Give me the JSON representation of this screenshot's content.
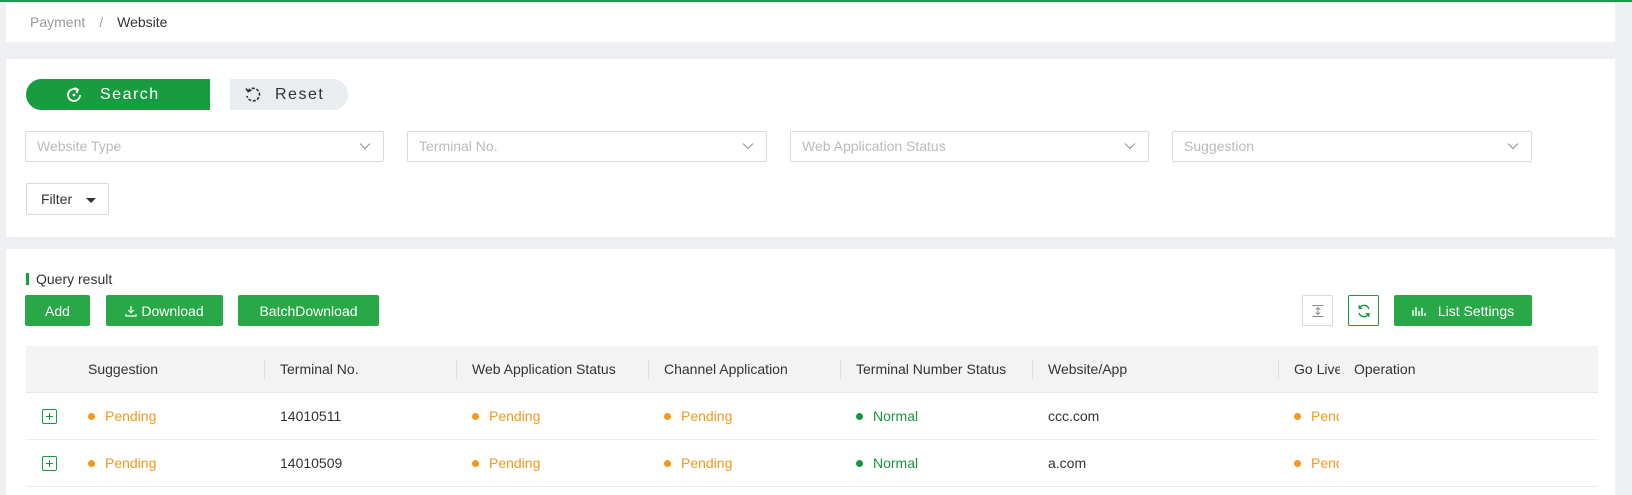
{
  "breadcrumb": {
    "parent": "Payment",
    "separator": "/",
    "current": "Website"
  },
  "search": {
    "search_label": "Search",
    "reset_label": "Reset"
  },
  "filters": [
    {
      "placeholder": "Website Type"
    },
    {
      "placeholder": "Terminal No."
    },
    {
      "placeholder": "Web Application Status"
    },
    {
      "placeholder": "Suggestion"
    }
  ],
  "filter_button": "Filter",
  "result": {
    "title": "Query result",
    "add_label": "Add",
    "download_label": "Download",
    "batch_download_label": "BatchDownload",
    "list_settings_label": "List Settings"
  },
  "table": {
    "columns": [
      "Suggestion",
      "Terminal No.",
      "Web Application Status",
      "Channel Application",
      "Terminal Number Status",
      "Website/App",
      "Go Live",
      "Operation"
    ],
    "rows": [
      {
        "suggestion": "Pending",
        "terminal": "14010511",
        "web_status": "Pending",
        "channel": "Pending",
        "terminal_status": "Normal",
        "website": "ccc.com",
        "go_live": "Pending"
      },
      {
        "suggestion": "Pending",
        "terminal": "14010509",
        "web_status": "Pending",
        "channel": "Pending",
        "terminal_status": "Normal",
        "website": "a.com",
        "go_live": "Pending"
      }
    ]
  },
  "colors": {
    "accent": "#189c40",
    "pending": "#f39a1b",
    "normal": "#17963f"
  }
}
